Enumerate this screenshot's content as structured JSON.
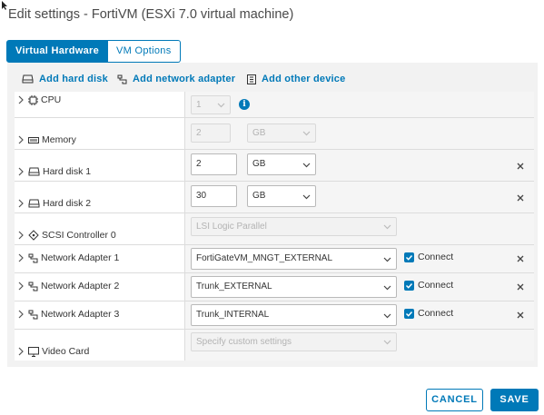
{
  "dialog": {
    "title": "Edit settings - FortiVM (ESXi 7.0 virtual machine)"
  },
  "tabs": [
    {
      "label": "Virtual Hardware",
      "active": true
    },
    {
      "label": "VM Options",
      "active": false
    }
  ],
  "toolbar": {
    "add_hard_disk": "Add hard disk",
    "add_network_adapter": "Add network adapter",
    "add_other_device": "Add other device"
  },
  "hardware": {
    "cpu": {
      "label": "CPU",
      "value": "1"
    },
    "memory": {
      "label": "Memory",
      "value": "2",
      "unit": "GB"
    },
    "hard_disk_1": {
      "label": "Hard disk 1",
      "value": "2",
      "unit": "GB"
    },
    "hard_disk_2": {
      "label": "Hard disk 2",
      "value": "30",
      "unit": "GB"
    },
    "scsi": {
      "label": "SCSI Controller 0",
      "value": "LSI Logic Parallel"
    },
    "net1": {
      "label": "Network Adapter 1",
      "value": "FortiGateVM_MNGT_EXTERNAL",
      "connect": "Connect",
      "connected": true
    },
    "net2": {
      "label": "Network Adapter 2",
      "value": "Trunk_EXTERNAL",
      "connect": "Connect",
      "connected": true
    },
    "net3": {
      "label": "Network Adapter 3",
      "value": "Trunk_INTERNAL",
      "connect": "Connect",
      "connected": true
    },
    "video": {
      "label": "Video Card",
      "placeholder": "Specify custom settings"
    }
  },
  "footer": {
    "cancel": "CANCEL",
    "save": "SAVE"
  },
  "colors": {
    "accent": "#0079b8",
    "panel": "#f2f2f2"
  }
}
